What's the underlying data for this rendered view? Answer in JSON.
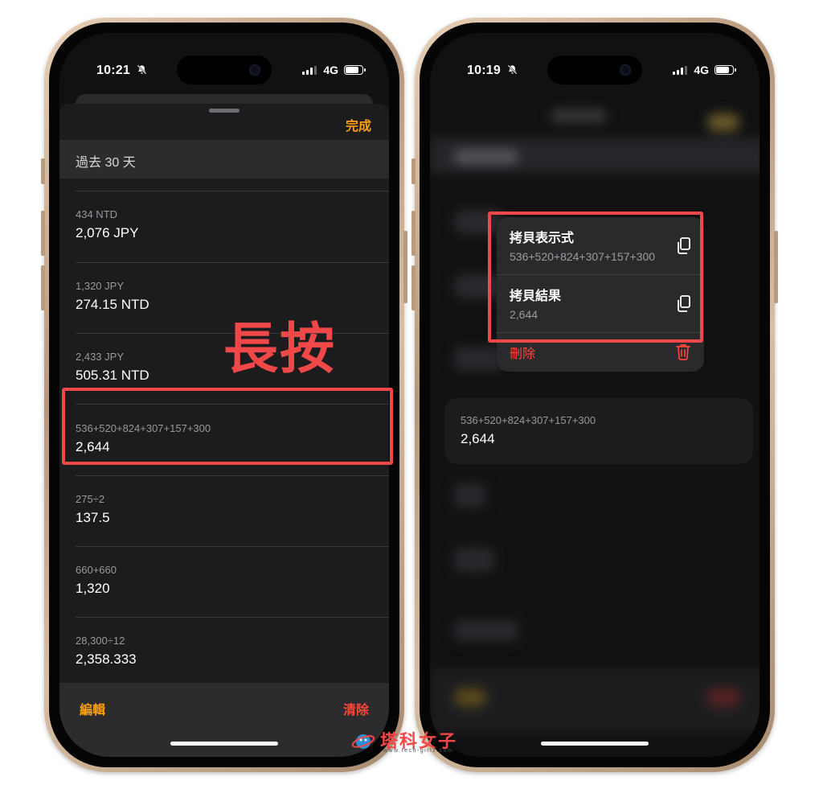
{
  "left": {
    "status": {
      "time": "10:21",
      "network": "4G"
    },
    "sheet": {
      "done_label": "完成",
      "section_header": "過去 30 天",
      "items": [
        {
          "expr": "434 NTD",
          "result": "2,076 JPY"
        },
        {
          "expr": "1,320 JPY",
          "result": "274.15 NTD"
        },
        {
          "expr": "2,433 JPY",
          "result": "505.31 NTD"
        },
        {
          "expr": "536+520+824+307+157+300",
          "result": "2,644"
        },
        {
          "expr": "275÷2",
          "result": "137.5"
        },
        {
          "expr": "660+660",
          "result": "1,320"
        },
        {
          "expr": "28,300÷12",
          "result": "2,358.333"
        }
      ],
      "edit_label": "編輯",
      "clear_label": "清除"
    },
    "callout": "長按"
  },
  "right": {
    "status": {
      "time": "10:19",
      "network": "4G"
    },
    "menu": {
      "copy_expression": {
        "title": "拷貝表示式",
        "value": "536+520+824+307+157+300"
      },
      "copy_result": {
        "title": "拷貝結果",
        "value": "2,644"
      },
      "delete_label": "刪除"
    },
    "preview": {
      "expr": "536+520+824+307+157+300",
      "result": "2,644"
    }
  },
  "watermark": {
    "name": "塔科女子",
    "url": "www.tech-girlz.com"
  },
  "colors": {
    "accent_orange": "#ff9f0a",
    "destructive_red": "#ff453a",
    "annotation_red": "#f04848"
  },
  "icons": [
    "bell-slash-icon",
    "signal-icon",
    "battery-icon",
    "copy-icon",
    "trash-icon"
  ]
}
